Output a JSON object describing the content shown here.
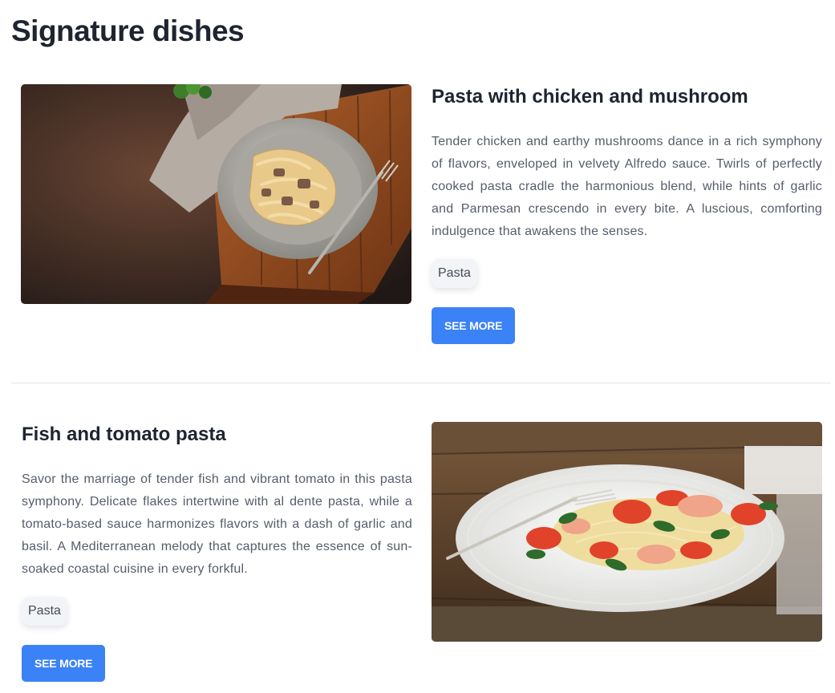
{
  "page": {
    "title": "Signature dishes"
  },
  "dishes": [
    {
      "title": "Pasta with chicken and mushroom",
      "description": "Tender chicken and earthy mushrooms dance in a rich symphony of flavors, enveloped in velvety Alfredo sauce. Twirls of perfectly cooked pasta cradle the harmonious blend, while hints of garlic and Parmesan crescendo in every bite. A luscious, comforting indulgence that awakens the senses.",
      "tag": "Pasta",
      "button_label": "SEE MORE",
      "image": "pasta-chicken-mushroom-photo"
    },
    {
      "title": "Fish and tomato pasta",
      "description": "Savor the marriage of tender fish and vibrant tomato in this pasta symphony. Delicate flakes intertwine with al dente pasta, while a tomato-based sauce harmonizes flavors with a dash of garlic and basil. A Mediterranean melody that captures the essence of sun-soaked coastal cuisine in every forkful.",
      "tag": "Pasta",
      "button_label": "SEE MORE",
      "image": "fish-tomato-pasta-photo"
    }
  ],
  "colors": {
    "accent": "#3b82f6",
    "heading": "#1e2430",
    "body_text": "#555d6b",
    "tag_bg": "#f3f4f7",
    "divider": "#e1e4ea"
  }
}
